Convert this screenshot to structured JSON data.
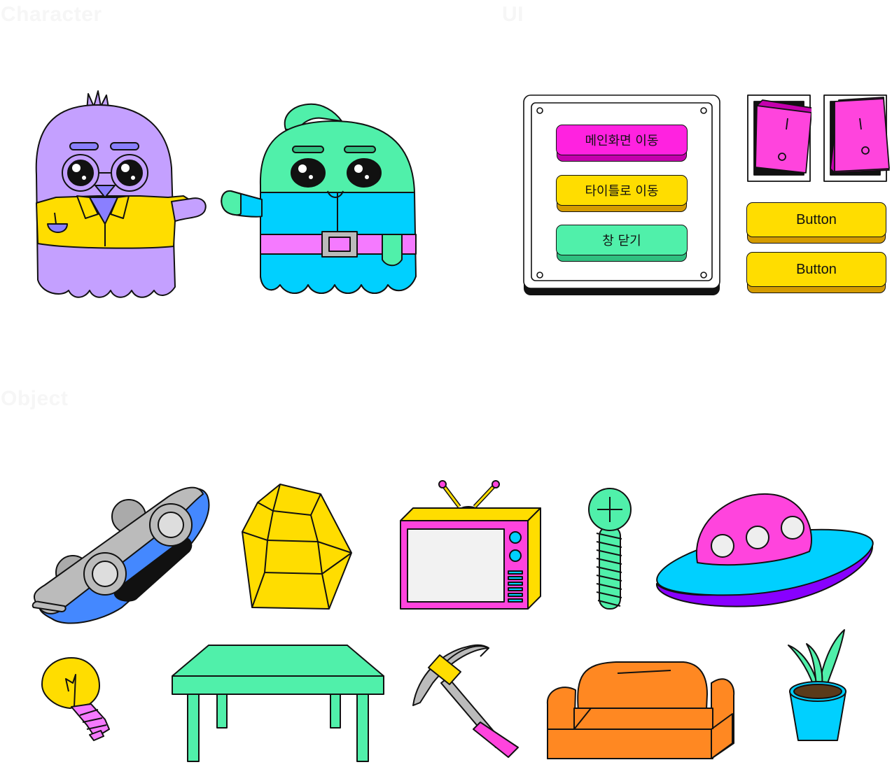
{
  "sections": {
    "character": "Character",
    "ui": "UI",
    "object": "Object"
  },
  "ui_panel": {
    "buttons": [
      {
        "label": "메인화면 이동",
        "color": "#ff22e0",
        "shade": "#c400ad"
      },
      {
        "label": "타이틀로 이동",
        "color": "#ffdd00",
        "shade": "#d49b00"
      },
      {
        "label": "창 닫기",
        "color": "#50f0aa",
        "shade": "#2fbf80"
      }
    ]
  },
  "side_buttons": [
    {
      "label": "Button"
    },
    {
      "label": "Button"
    }
  ],
  "switches": [
    {
      "state": "off",
      "color": "#ff44dd"
    },
    {
      "state": "off",
      "color": "#ff44dd"
    }
  ],
  "characters": [
    {
      "icon": "owl-character-icon",
      "color": "#c4a0ff"
    },
    {
      "icon": "green-ghost-character-icon",
      "color": "#50f0aa"
    }
  ],
  "objects": [
    "flipped-car-icon",
    "gold-ore-icon",
    "retro-tv-icon",
    "screw-icon",
    "ufo-icon",
    "light-bulb-icon",
    "table-icon",
    "pickaxe-icon",
    "sofa-icon",
    "potted-plant-icon"
  ],
  "palette": {
    "yellow": "#ffdd00",
    "pink": "#ff44dd",
    "green": "#50f0aa",
    "cyan": "#00d0ff",
    "purple": "#c4a0ff",
    "orange": "#ff8822",
    "blue": "#4488ff",
    "violet": "#8800ff"
  }
}
